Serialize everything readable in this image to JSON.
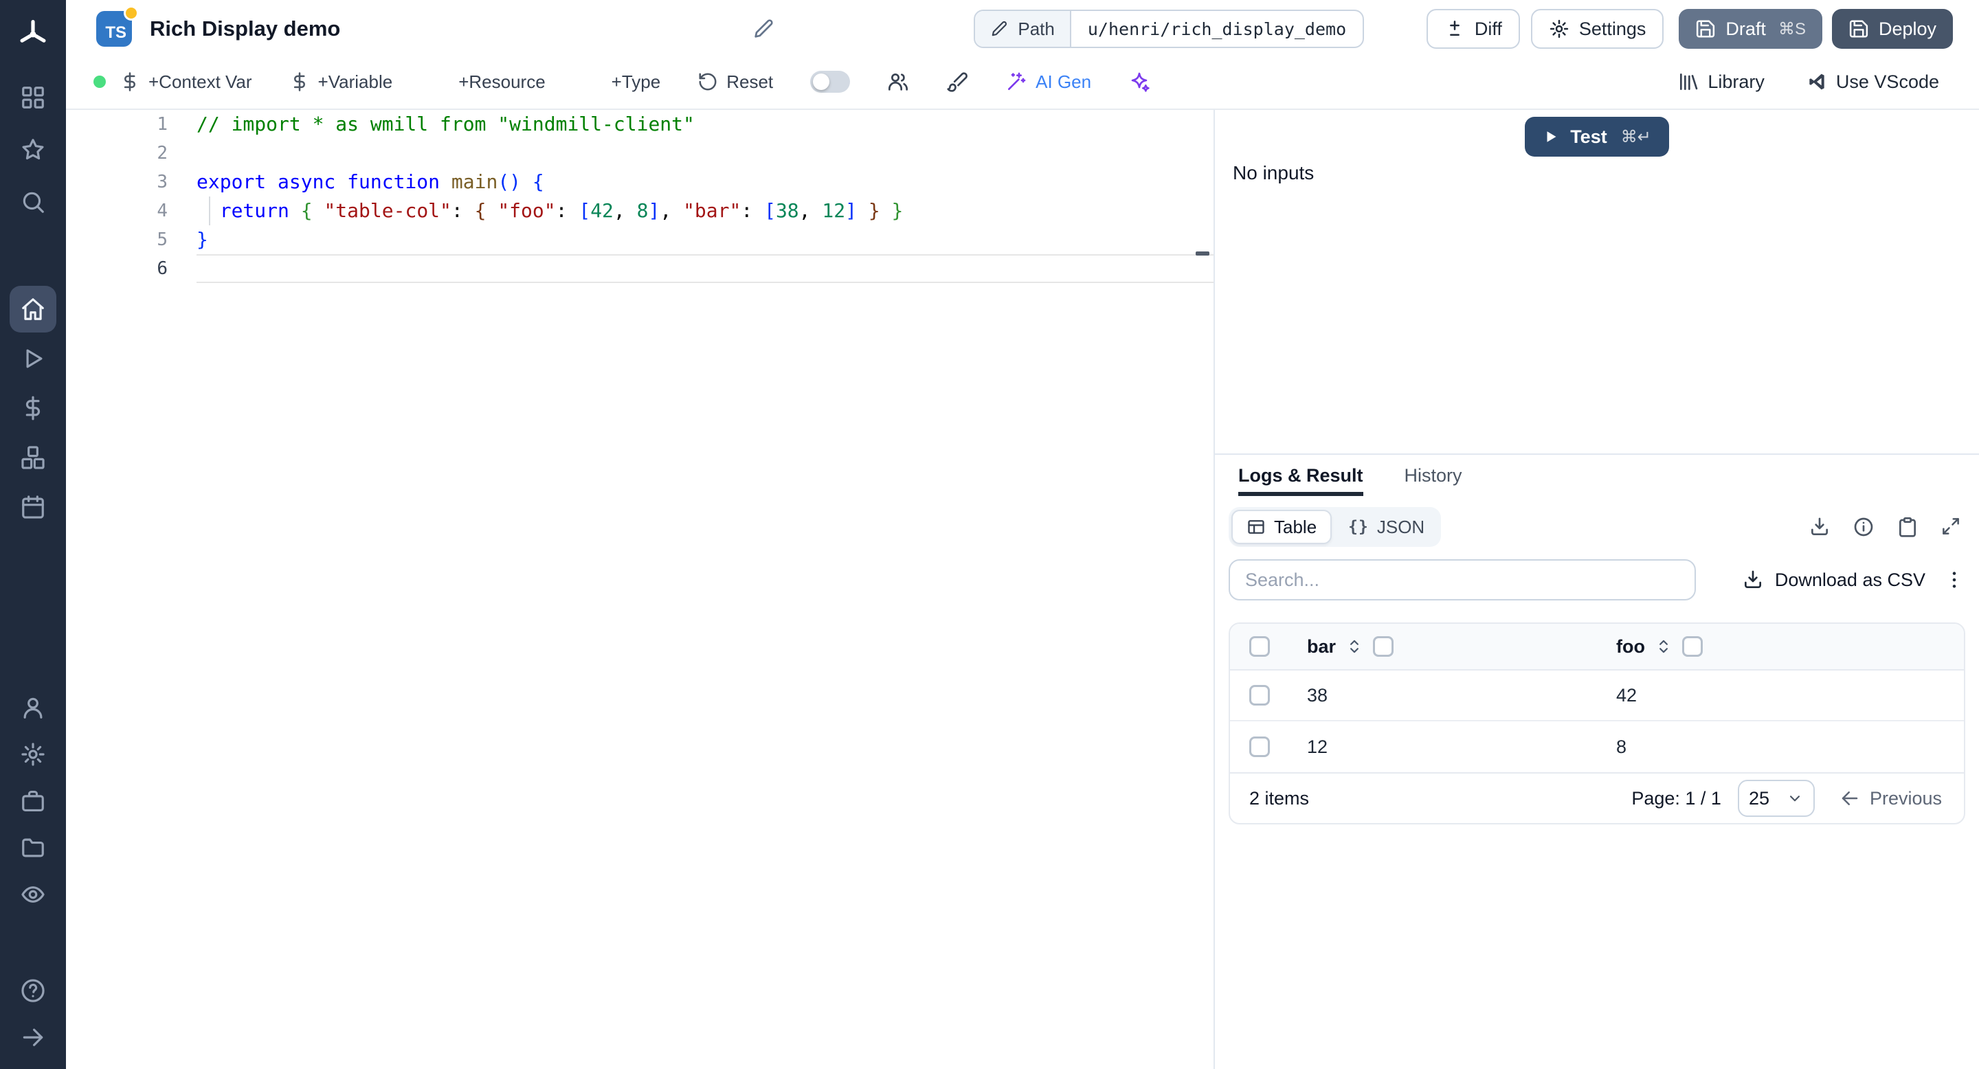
{
  "header": {
    "ts_badge": "TS",
    "title": "Rich Display demo",
    "path_button": "Path",
    "path_value": "u/henri/rich_display_demo",
    "diff": "Diff",
    "settings": "Settings",
    "draft": "Draft",
    "draft_shortcut": "⌘S",
    "deploy": "Deploy"
  },
  "toolbar": {
    "context_var": "+Context Var",
    "variable": "+Variable",
    "resource": "+Resource",
    "type": "+Type",
    "reset": "Reset",
    "ai_gen": "AI Gen",
    "library": "Library",
    "vscode": "Use VScode"
  },
  "sidebar": {
    "active": "home-icon",
    "groups": {
      "top": [
        "grid-icon",
        "star-icon",
        "search-icon"
      ],
      "middle": [
        "home-icon",
        "play-icon",
        "dollar-icon",
        "boxes-icon",
        "calendar-icon"
      ],
      "lower": [
        "user-icon",
        "settings-icon",
        "briefcase-icon",
        "folder-icon",
        "eye-icon"
      ],
      "bottom": [
        "help-icon",
        "arrow-right-icon"
      ]
    }
  },
  "editor": {
    "lines": [
      {
        "n": "1",
        "tokens": [
          {
            "t": "// import * as wmill from \"windmill-client\"",
            "c": "cm"
          }
        ]
      },
      {
        "n": "2",
        "tokens": []
      },
      {
        "n": "3",
        "tokens": [
          {
            "t": "export async function ",
            "c": "kw"
          },
          {
            "t": "main",
            "c": "fn"
          },
          {
            "t": "() {",
            "c": "pun"
          }
        ]
      },
      {
        "n": "4",
        "tokens": [
          {
            "t": "  ",
            "c": ""
          },
          {
            "t": "return",
            "c": "kw"
          },
          {
            "t": " ",
            "c": ""
          },
          {
            "t": "{",
            "c": "b2"
          },
          {
            "t": " ",
            "c": ""
          },
          {
            "t": "\"table-col\"",
            "c": "str"
          },
          {
            "t": ": ",
            "c": ""
          },
          {
            "t": "{",
            "c": "b3"
          },
          {
            "t": " ",
            "c": ""
          },
          {
            "t": "\"foo\"",
            "c": "str"
          },
          {
            "t": ": ",
            "c": ""
          },
          {
            "t": "[",
            "c": "b1"
          },
          {
            "t": "42",
            "c": "num"
          },
          {
            "t": ", ",
            "c": ""
          },
          {
            "t": "8",
            "c": "num"
          },
          {
            "t": "]",
            "c": "b1"
          },
          {
            "t": ", ",
            "c": ""
          },
          {
            "t": "\"bar\"",
            "c": "str"
          },
          {
            "t": ": ",
            "c": ""
          },
          {
            "t": "[",
            "c": "b1"
          },
          {
            "t": "38",
            "c": "num"
          },
          {
            "t": ", ",
            "c": ""
          },
          {
            "t": "12",
            "c": "num"
          },
          {
            "t": "]",
            "c": "b1"
          },
          {
            "t": " ",
            "c": ""
          },
          {
            "t": "}",
            "c": "b3"
          },
          {
            "t": " ",
            "c": ""
          },
          {
            "t": "}",
            "c": "b2"
          }
        ]
      },
      {
        "n": "5",
        "tokens": [
          {
            "t": "}",
            "c": "pun"
          }
        ]
      },
      {
        "n": "6",
        "tokens": [],
        "current": true
      }
    ]
  },
  "run_panel": {
    "test": "Test",
    "test_shortcut": "⌘↵",
    "no_inputs": "No inputs"
  },
  "result_panel": {
    "tabs": [
      {
        "label": "Logs & Result",
        "active": true
      },
      {
        "label": "History",
        "active": false
      }
    ],
    "view_toggle": [
      {
        "label": "Table",
        "icon": "table",
        "active": true
      },
      {
        "label": "JSON",
        "glyph": "{}",
        "active": false
      }
    ],
    "search_placeholder": "Search...",
    "download_csv": "Download as CSV",
    "table": {
      "columns": [
        "bar",
        "foo"
      ],
      "rows": [
        [
          "38",
          "42"
        ],
        [
          "12",
          "8"
        ]
      ],
      "items_label": "2 items",
      "page_label": "Page: 1 / 1",
      "page_size": "25",
      "prev": "Previous"
    }
  },
  "colors": {
    "sidebar_bg": "#202b3d",
    "ts_badge": "#3178c6",
    "success_green": "#4ade80",
    "ai_accent": "#3b82f6",
    "ai_icon": "#7c3aed",
    "test_button": "#2e4a6d",
    "draft_button": "#64748b",
    "deploy_button": "#475569",
    "tab_underline": "#1f2937"
  }
}
